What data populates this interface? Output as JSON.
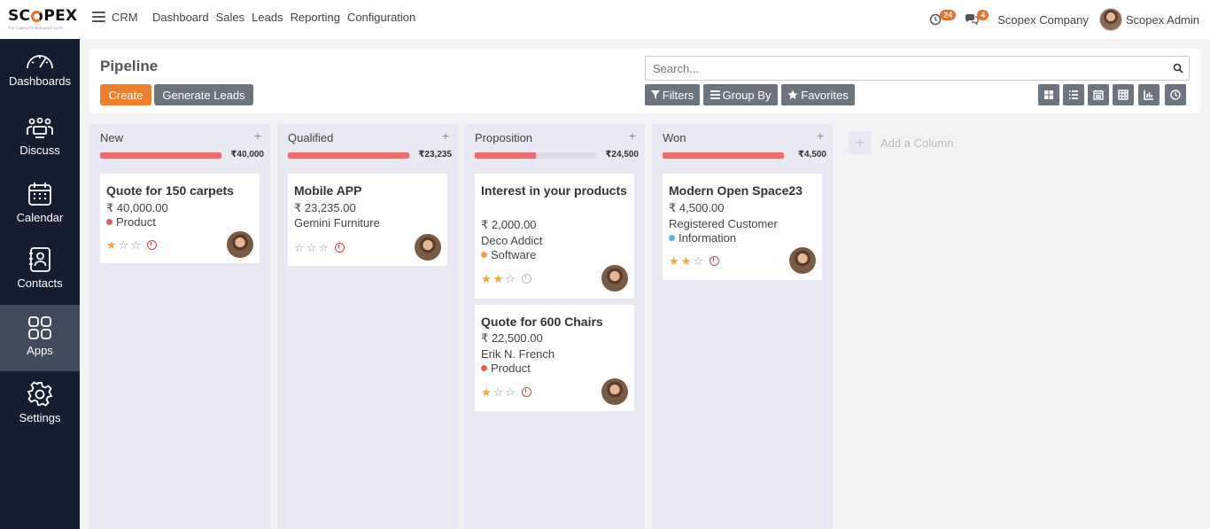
{
  "brand": {
    "name_left": "SC",
    "name_right": "PEX",
    "tagline": "THE COMPLETE BUSINESS SUITE"
  },
  "topbar": {
    "app_name": "CRM",
    "menu": [
      "Dashboard",
      "Sales",
      "Leads",
      "Reporting",
      "Configuration"
    ],
    "activities_count": "24",
    "messages_count": "4",
    "company": "Scopex Company",
    "user": "Scopex Admin"
  },
  "sidebar": {
    "items": [
      {
        "label": "Dashboards",
        "icon": "gauge-icon"
      },
      {
        "label": "Discuss",
        "icon": "team-icon"
      },
      {
        "label": "Calendar",
        "icon": "calendar-icon"
      },
      {
        "label": "Contacts",
        "icon": "contacts-icon"
      },
      {
        "label": "Apps",
        "icon": "apps-grid-icon"
      },
      {
        "label": "Settings",
        "icon": "gear-icon"
      }
    ],
    "active": "Apps"
  },
  "control": {
    "title": "Pipeline",
    "create_label": "Create",
    "generate_label": "Generate Leads",
    "search_placeholder": "Search...",
    "filters_label": "Filters",
    "groupby_label": "Group By",
    "favorites_label": "Favorites",
    "views": [
      "kanban-view-icon",
      "list-view-icon",
      "calendar-view-icon",
      "pivot-view-icon",
      "graph-view-icon",
      "activity-view-icon"
    ]
  },
  "kanban": {
    "columns": [
      {
        "name": "New",
        "total": "₹40,000",
        "progress": 1.0,
        "cards": [
          {
            "title": "Quote for 150 carpets",
            "amount": "₹ 40,000.00",
            "partner": "",
            "tag": "Product",
            "tag_color": "#e25e5e",
            "stars": 1,
            "activity": "overdue"
          }
        ]
      },
      {
        "name": "Qualified",
        "total": "₹23,235",
        "progress": 1.0,
        "cards": [
          {
            "title": "Mobile APP",
            "amount": "₹ 23,235.00",
            "partner": "Gemini Furniture",
            "tag": "",
            "tag_color": "",
            "stars": 0,
            "activity": "overdue"
          }
        ]
      },
      {
        "name": "Proposition",
        "total": "₹24,500",
        "progress": 0.5,
        "cards": [
          {
            "title": "Interest in your products",
            "amount": "₹ 2,000.00",
            "partner": "Deco Addict",
            "tag": "Software",
            "tag_color": "#f0a050",
            "stars": 2,
            "activity": "none"
          },
          {
            "title": "Quote for 600 Chairs",
            "amount": "₹ 22,500.00",
            "partner": "Erik N. French",
            "tag": "Product",
            "tag_color": "#e25e5e",
            "stars": 1,
            "activity": "overdue"
          }
        ]
      },
      {
        "name": "Won",
        "total": "₹4,500",
        "progress": 1.0,
        "cards": [
          {
            "title": "Modern Open Space23",
            "amount": "₹ 4,500.00",
            "partner": "Registered Customer",
            "tag": "Information",
            "tag_color": "#5fb0e0",
            "stars": 2,
            "activity": "overdue"
          }
        ]
      }
    ],
    "add_column_label": "Add a Column"
  }
}
